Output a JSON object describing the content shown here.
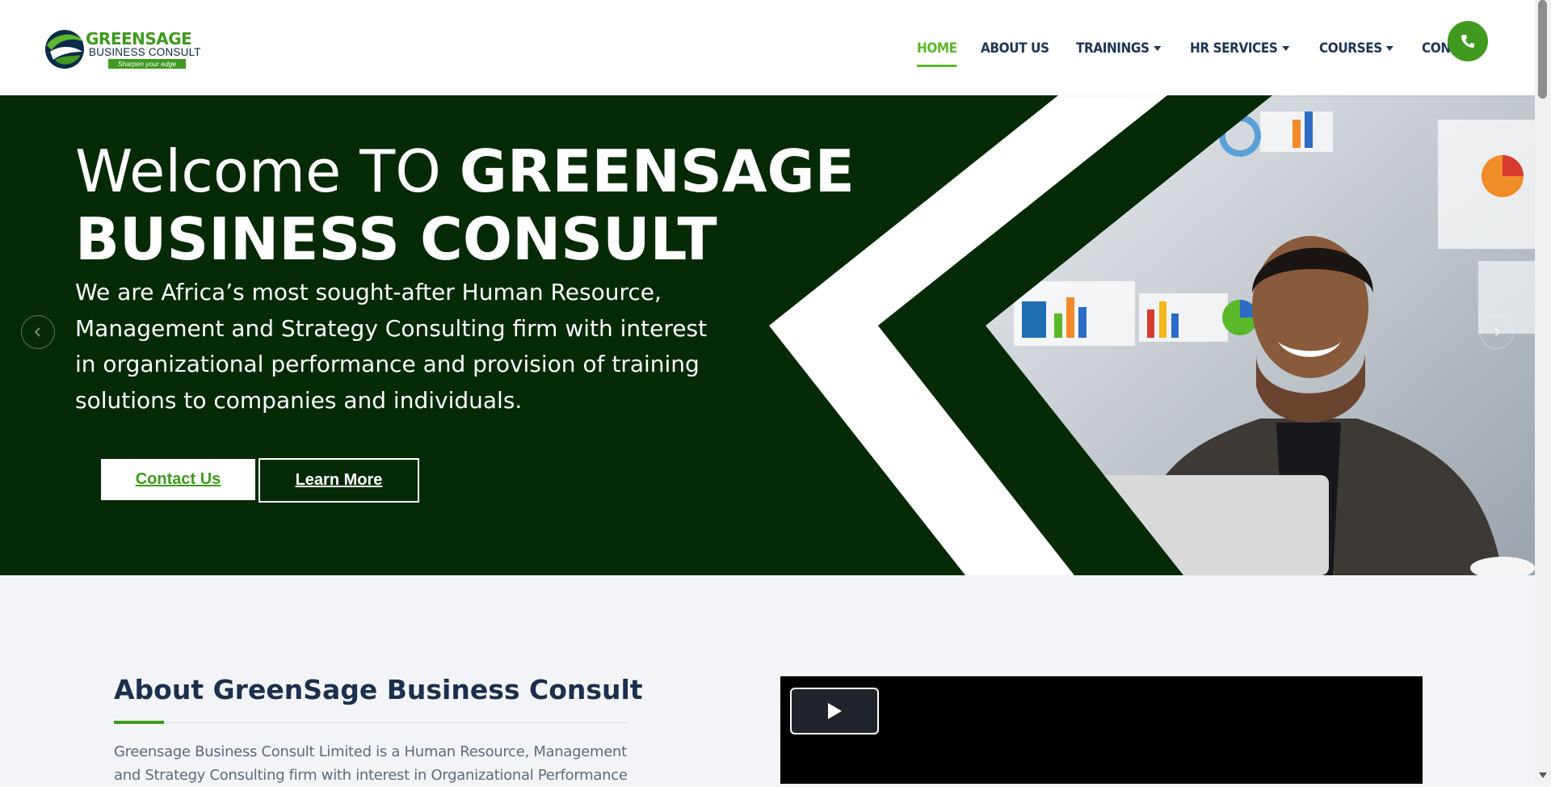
{
  "brand": {
    "name_line1": "GREENSAGE",
    "name_line2": "BUSINESS CONSULT",
    "tagline": "Sharpen your edge"
  },
  "nav": {
    "items": [
      {
        "label": "HOME",
        "active": true,
        "dropdown": false
      },
      {
        "label": "ABOUT US",
        "active": false,
        "dropdown": false
      },
      {
        "label": "TRAININGS",
        "active": false,
        "dropdown": true
      },
      {
        "label": "HR SERVICES",
        "active": false,
        "dropdown": true
      },
      {
        "label": "COURSES",
        "active": false,
        "dropdown": true
      },
      {
        "label": "CONTACT",
        "active": false,
        "dropdown": false
      }
    ],
    "cta_icon": "phone-icon"
  },
  "hero": {
    "title_light": "Welcome TO",
    "title_bold": "GREENSAGE BUSINESS CONSULT",
    "description": "We are Africa’s most sought-after Human Resource, Management and Strategy Consulting firm with interest in organizational performance and provision of training solutions to companies and individuals.",
    "primary_button": "Contact Us",
    "secondary_button": "Learn More",
    "prev_icon": "chevron-left-icon",
    "next_icon": "chevron-right-icon"
  },
  "about": {
    "title": "About GreenSage Business Consult",
    "text": "Greensage Business Consult Limited is a Human Resource, Management and Strategy Consulting firm with interest in Organizational Performance",
    "video_icon": "play-icon"
  },
  "colors": {
    "brand_green": "#3f9a1f",
    "nav_active": "#5bb82a",
    "navy": "#1d3557",
    "hero_bg": "#062a06"
  }
}
